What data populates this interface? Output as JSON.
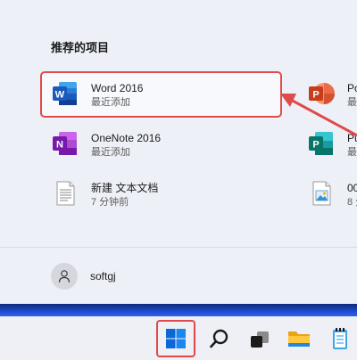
{
  "start_menu": {
    "section_title": "推荐的项目",
    "items_left": [
      {
        "name": "Word 2016",
        "sub": "最近添加",
        "icon": "word-icon"
      },
      {
        "name": "OneNote 2016",
        "sub": "最近添加",
        "icon": "onenote-icon"
      },
      {
        "name": "新建 文本文档",
        "sub": "7 分钟前",
        "icon": "text-document-icon"
      }
    ],
    "items_right": [
      {
        "name": "Po",
        "sub": "最",
        "icon": "powerpoint-icon"
      },
      {
        "name": "Pu",
        "sub": "最",
        "icon": "publisher-icon"
      },
      {
        "name": "00",
        "sub": "8 分",
        "icon": "image-file-icon"
      }
    ],
    "user": {
      "name": "softgj"
    }
  },
  "taskbar": {
    "buttons": [
      "start-icon",
      "search-icon",
      "task-view-icon",
      "file-explorer-icon",
      "notepad-icon"
    ]
  },
  "colors": {
    "highlight": "#e04a4a",
    "word": "#2b579a",
    "onenote": "#7719aa",
    "powerpoint": "#d24726",
    "publisher": "#077568",
    "windows": "#0a67d6"
  }
}
